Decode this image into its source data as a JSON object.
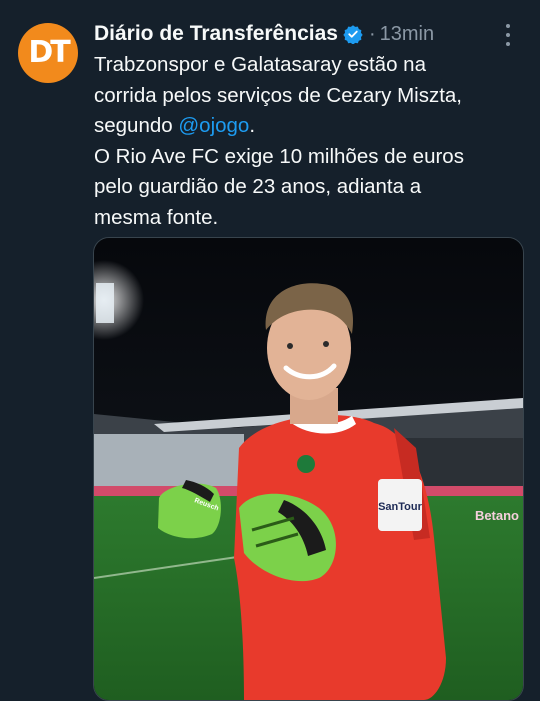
{
  "author": {
    "name": "Diário de Transferências",
    "avatar_text": "DT",
    "verified": true
  },
  "meta": {
    "separator": "·",
    "time": "13min"
  },
  "tweet": {
    "line1": "Trabzonspor e Galatasaray estão na",
    "line2": "corrida pelos serviços de Cezary Miszta,",
    "line3_prefix": "segundo ",
    "mention": "@ojogo",
    "line3_suffix": ".",
    "line4": "O Rio Ave FC exige 10 milhões de euros",
    "line5": "pelo guardião de 23 anos, adianta a",
    "line6": "mesma fonte."
  },
  "image": {
    "jersey_sponsor": "SanTour",
    "glove_brand": "Reusch",
    "board_text": "Betano"
  },
  "colors": {
    "background": "#15202b",
    "accent": "#1d9bf0",
    "avatar": "#f28a1c",
    "jersey": "#e83a2c"
  }
}
